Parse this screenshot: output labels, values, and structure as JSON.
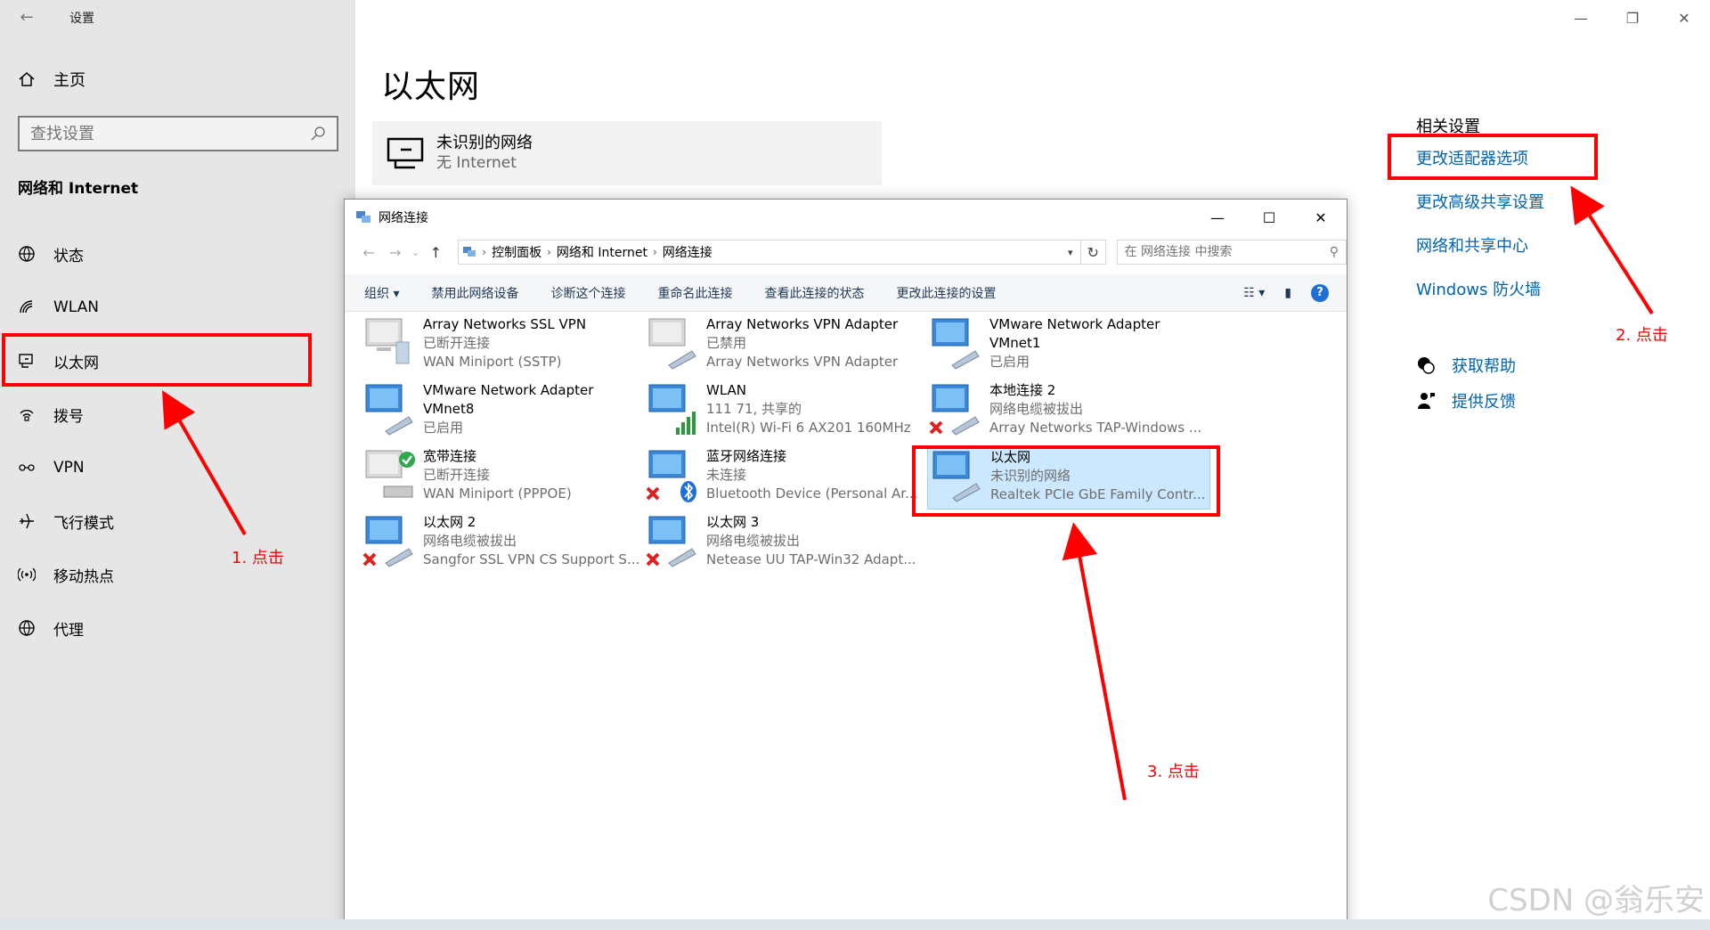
{
  "settings": {
    "title": "设置",
    "home": "主页",
    "search_placeholder": "查找设置",
    "section": "网络和 Internet",
    "nav": [
      {
        "label": "状态"
      },
      {
        "label": "WLAN"
      },
      {
        "label": "以太网"
      },
      {
        "label": "拨号"
      },
      {
        "label": "VPN"
      },
      {
        "label": "飞行模式"
      },
      {
        "label": "移动热点"
      },
      {
        "label": "代理"
      }
    ]
  },
  "main": {
    "heading": "以太网",
    "network_name": "未识别的网络",
    "network_status": "无 Internet",
    "related_title": "相关设置",
    "related_links": [
      "更改适配器选项",
      "更改高级共享设置",
      "网络和共享中心",
      "Windows 防火墙"
    ],
    "get_help": "获取帮助",
    "feedback": "提供反馈"
  },
  "nc_window": {
    "title": "网络连接",
    "breadcrumb": [
      "控制面板",
      "网络和 Internet",
      "网络连接"
    ],
    "search_placeholder": "在 网络连接 中搜索",
    "toolbar": [
      "组织 ▾",
      "禁用此网络设备",
      "诊断这个连接",
      "重命名此连接",
      "查看此连接的状态",
      "更改此连接的设置"
    ],
    "connections": [
      {
        "name": "Array Networks SSL VPN",
        "status": "已断开连接",
        "device": "WAN Miniport (SSTP)"
      },
      {
        "name": "Array Networks VPN Adapter",
        "status": "已禁用",
        "device": "Array Networks VPN Adapter"
      },
      {
        "name": "VMware Network Adapter",
        "status": "VMnet1",
        "device": "已启用"
      },
      {
        "name": "VMware Network Adapter",
        "status": "VMnet8",
        "device": "已启用"
      },
      {
        "name": "WLAN",
        "status": "111 71, 共享的",
        "device": "Intel(R) Wi-Fi 6 AX201 160MHz"
      },
      {
        "name": "本地连接 2",
        "status": "网络电缆被拔出",
        "device": "Array Networks TAP-Windows ..."
      },
      {
        "name": "宽带连接",
        "status": "已断开连接",
        "device": "WAN Miniport (PPPOE)"
      },
      {
        "name": "蓝牙网络连接",
        "status": "未连接",
        "device": "Bluetooth Device (Personal Ar..."
      },
      {
        "name": "以太网",
        "status": "未识别的网络",
        "device": "Realtek PCIe GbE Family Contr..."
      },
      {
        "name": "以太网 2",
        "status": "网络电缆被拔出",
        "device": "Sangfor SSL VPN CS Support S..."
      },
      {
        "name": "以太网 3",
        "status": "网络电缆被拔出",
        "device": "Netease UU TAP-Win32 Adapt..."
      }
    ]
  },
  "annotations": {
    "step1": "1. 点击",
    "step2": "2. 点击",
    "step3": "3. 点击",
    "color": "#ff0000"
  },
  "watermark": "CSDN @翁乐安"
}
